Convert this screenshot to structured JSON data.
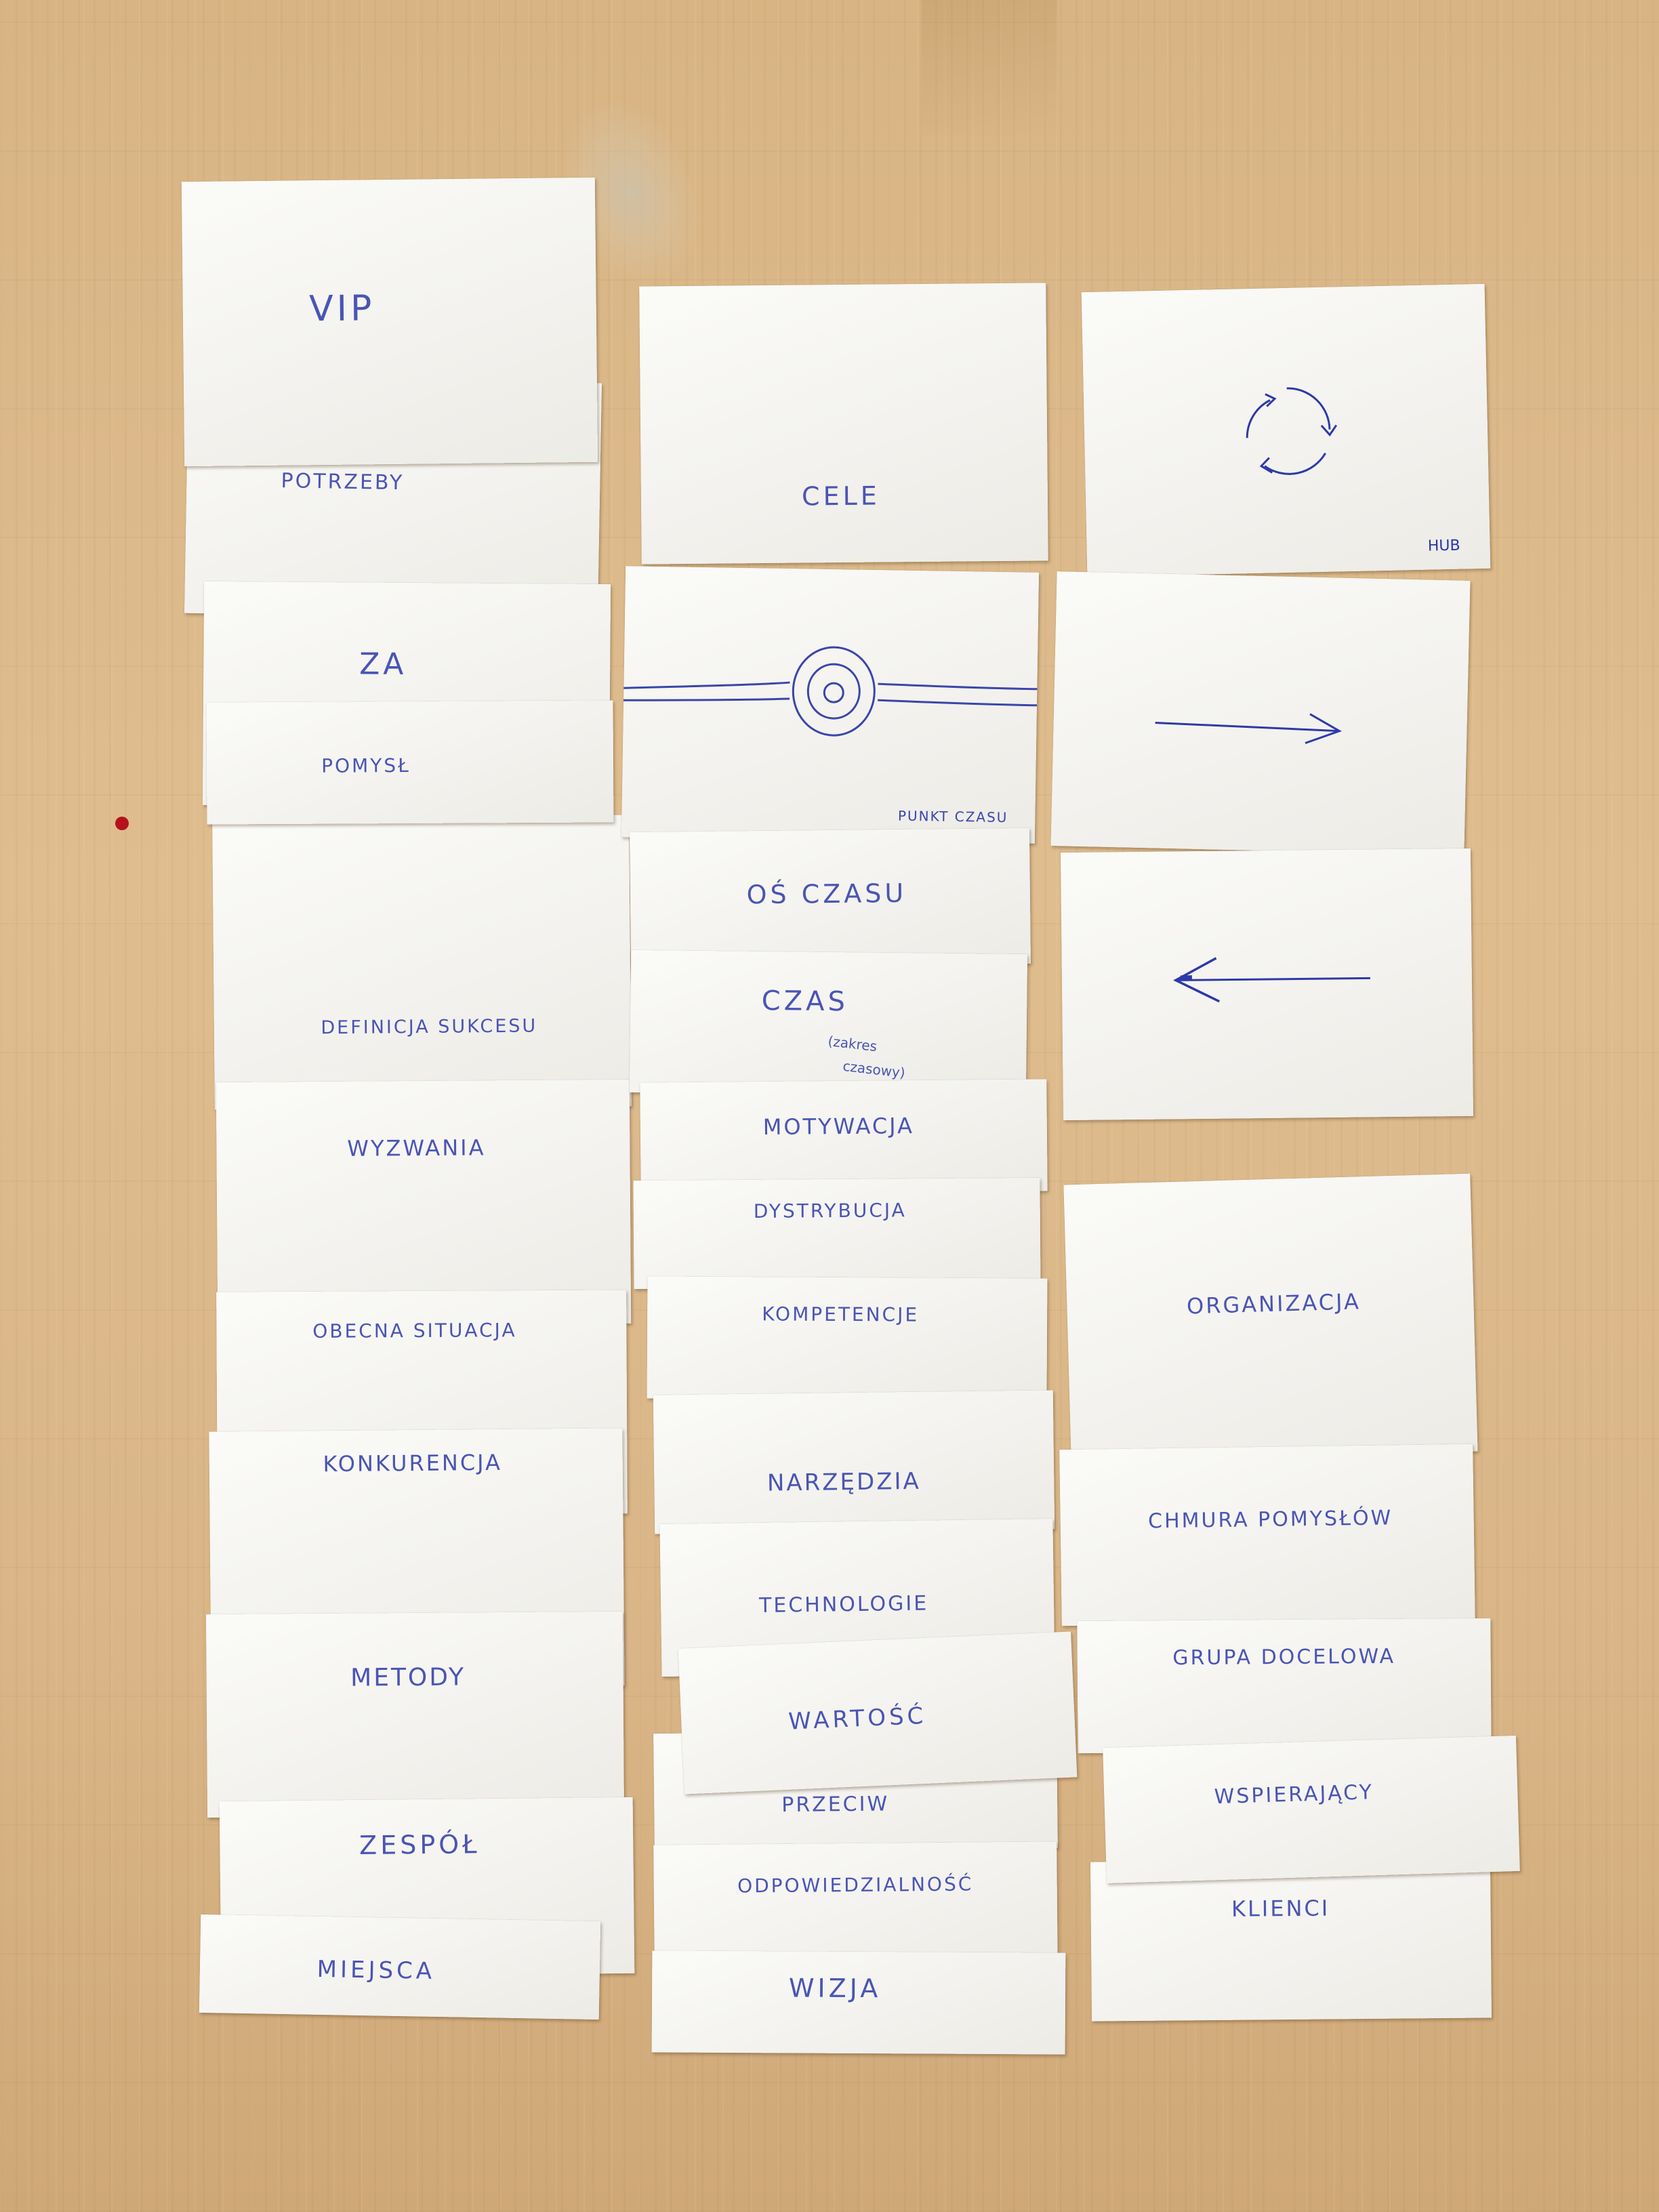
{
  "photo": {
    "subject": "handwritten index cards on a wooden table"
  },
  "cards": {
    "vip": "VIP",
    "potrzeby": "POTRZEBY",
    "za": "ZA",
    "pomysl": "POMYSŁ",
    "definicja_sukcesu": "DEFINICJA SUKCESU",
    "wyzwania": "WYZWANIA",
    "obecna_sytuacja": "OBECNA SITUACJA",
    "konkurencja": "KONKURENCJA",
    "metody": "METODY",
    "zespol": "ZESPÓŁ",
    "miejsca": "MIEJSCA",
    "cele": "CELE",
    "punkt_czasu": "PUNKT CZASU",
    "os_czasu": "OŚ CZASU",
    "czas": "CZAS",
    "czas_note_1": "(zakres",
    "czas_note_2": "czasowy)",
    "motywacja": "MOTYWACJA",
    "dystrybucja": "DYSTRYBUCJA",
    "kompetencje": "KOMPETENCJE",
    "narzedzia": "NARZĘDZIA",
    "technologie": "TECHNOLOGIE",
    "wartosc": "WARTOŚĆ",
    "przeciw": "PRZECIW",
    "odpowiedzialnosc": "ODPOWIEDZIALNOŚĆ",
    "wizja": "WIZJA",
    "hub": "HUB",
    "organizacja": "ORGANIZACJA",
    "chmura_pomyslow": "CHMURA POMYSŁÓW",
    "grupa_docelowa": "GRUPA DOCELOWA",
    "wspierajacy": "WSPIERAJĄCY",
    "klienci": "KLIENCI"
  },
  "icons": {
    "cycle": "cycle-arrows-icon",
    "right_arrow": "right-arrow-icon",
    "left_arrow": "left-arrow-icon",
    "timeline": "timeline-point-icon"
  },
  "colors": {
    "ink": "#4a55b4",
    "table": "#dcb98a",
    "paper": "#f4f3ef"
  }
}
